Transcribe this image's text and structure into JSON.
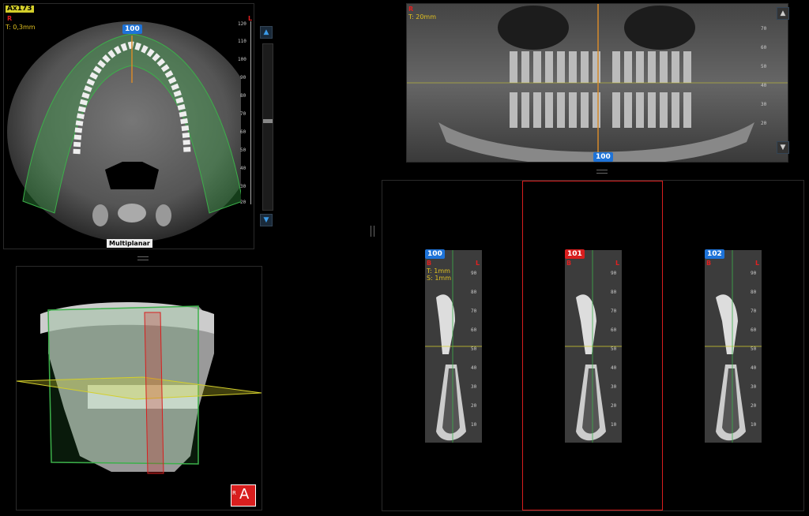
{
  "axial": {
    "slice_tag": "Ax173",
    "orient_r": "R",
    "orient_l": "L",
    "thickness": "T: 0,3mm",
    "badge": "100",
    "mode_label": "Multiplanar",
    "ruler_ticks": [
      "120",
      "110",
      "100",
      "90",
      "80",
      "70",
      "60",
      "50",
      "40",
      "30",
      "20"
    ],
    "scroll_up": "▲",
    "scroll_down": "▼",
    "slider_position": 0.45
  },
  "panoramic": {
    "orient_r": "R",
    "thickness": "T: 20mm",
    "badge": "100",
    "ruler_ticks": [
      "70",
      "60",
      "50",
      "40",
      "30",
      "20"
    ]
  },
  "render3d": {
    "orientation_label": "A",
    "orientation_side": "R"
  },
  "cross_sections": [
    {
      "badge": "100",
      "badge_color": "blue",
      "orient_b": "B",
      "orient_l": "L",
      "thickness": "T: 1mm",
      "spacing": "S: 1mm",
      "ruler_ticks": [
        "90",
        "80",
        "70",
        "60",
        "50",
        "40",
        "30",
        "20",
        "10"
      ]
    },
    {
      "badge": "101",
      "badge_color": "red",
      "orient_b": "B",
      "orient_l": "L",
      "ruler_ticks": [
        "90",
        "80",
        "70",
        "60",
        "50",
        "40",
        "30",
        "20",
        "10"
      ]
    },
    {
      "badge": "102",
      "badge_color": "blue",
      "orient_b": "B",
      "orient_l": "L",
      "ruler_ticks": [
        "90",
        "80",
        "70",
        "60",
        "50",
        "40",
        "30",
        "20",
        "10"
      ]
    }
  ],
  "colors": {
    "accent_blue": "#1e73d8",
    "accent_red": "#d81e1e",
    "guide_green": "#3cb04a",
    "guide_yellow": "#d4cf2b",
    "orange_line": "#d68a2b"
  }
}
